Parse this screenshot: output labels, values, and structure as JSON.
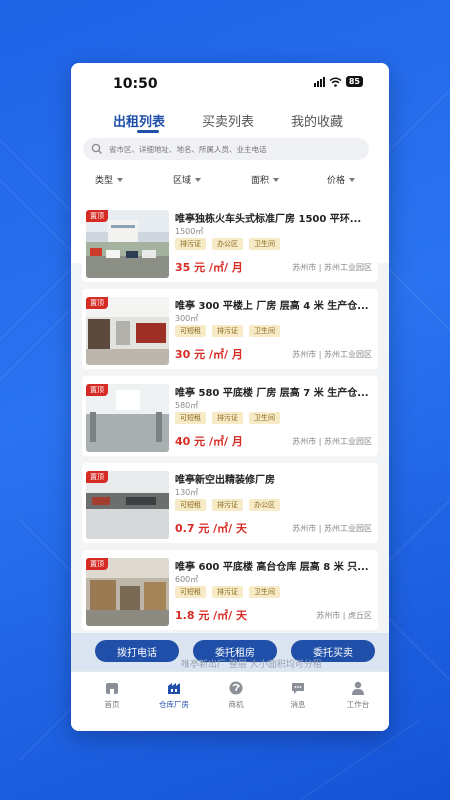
{
  "status_bar": {
    "time": "10:50",
    "battery": "85"
  },
  "tabs": [
    {
      "label": "出租列表",
      "active": true
    },
    {
      "label": "买卖列表",
      "active": false
    },
    {
      "label": "我的收藏",
      "active": false
    }
  ],
  "search": {
    "placeholder": "省市区、详细地址、地名、所属人员、业主电话"
  },
  "filters": [
    {
      "label": "类型"
    },
    {
      "label": "区域"
    },
    {
      "label": "面积"
    },
    {
      "label": "价格"
    }
  ],
  "listings": [
    {
      "badge": "置顶",
      "title": "唯亭独栋火车头式标准厂房 1500 平环...",
      "area": "1500㎡",
      "tags": [
        "排污证",
        "办公区",
        "卫生间"
      ],
      "price": "35 元 /㎡/ 月",
      "location": "苏州市 | 苏州工业园区"
    },
    {
      "badge": "置顶",
      "title": "唯亭 300 平楼上 厂房 层高 4 米 生产仓...",
      "area": "300㎡",
      "tags": [
        "可短租",
        "排污证",
        "卫生间"
      ],
      "price": "30 元 /㎡/ 月",
      "location": "苏州市 | 苏州工业园区"
    },
    {
      "badge": "置顶",
      "title": "唯亭 580 平底楼 厂房 层高 7 米 生产仓...",
      "area": "580㎡",
      "tags": [
        "可短租",
        "排污证",
        "卫生间"
      ],
      "price": "40 元 /㎡/ 月",
      "location": "苏州市 | 苏州工业园区"
    },
    {
      "badge": "置顶",
      "title": "唯亭新空出精装修厂房",
      "area": "130㎡",
      "tags": [
        "可短租",
        "排污证",
        "办公区"
      ],
      "price": "0.7 元 /㎡/ 天",
      "location": "苏州市 | 苏州工业园区"
    },
    {
      "badge": "置顶",
      "title": "唯亭 600 平底楼 高台仓库 层高 8 米 只...",
      "area": "600㎡",
      "tags": [
        "可短租",
        "排污证",
        "卫生间"
      ],
      "price": "1.8 元 /㎡/ 天",
      "location": "苏州市 | 虎丘区"
    }
  ],
  "action_buttons": [
    "拨打电话",
    "委托租房",
    "委托买卖"
  ],
  "partial_listing_title": "唯亭新出厂 整层 大小面积均可分租",
  "bottom_nav": [
    {
      "label": "首页",
      "icon": "home-icon",
      "active": false
    },
    {
      "label": "仓库厂房",
      "icon": "warehouse-icon",
      "active": true
    },
    {
      "label": "商机",
      "icon": "opportunity-icon",
      "active": false
    },
    {
      "label": "消息",
      "icon": "message-icon",
      "active": false
    },
    {
      "label": "工作台",
      "icon": "profile-icon",
      "active": false
    }
  ],
  "colors": {
    "primary": "#1f4fa8",
    "price": "#d82b23",
    "badge": "#d62b24",
    "tag_bg": "#f7eac6",
    "background": "#2a73f0"
  }
}
